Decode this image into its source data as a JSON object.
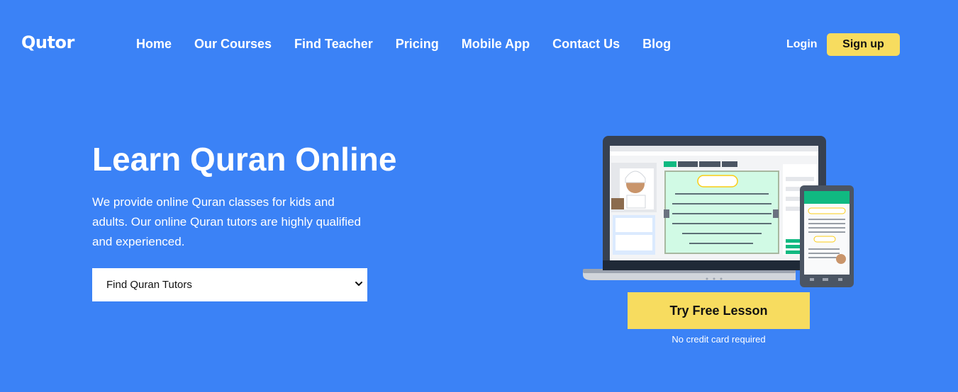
{
  "brand": {
    "logo_text": "Qutor"
  },
  "nav": {
    "items": [
      {
        "label": "Home"
      },
      {
        "label": "Our Courses"
      },
      {
        "label": "Find Teacher"
      },
      {
        "label": "Pricing"
      },
      {
        "label": "Mobile App"
      },
      {
        "label": "Contact Us"
      },
      {
        "label": "Blog"
      }
    ],
    "login_label": "Login",
    "signup_label": "Sign up"
  },
  "hero": {
    "title": "Learn Quran Online",
    "description": "We provide online Quran classes for kids and adults. Our online Quran tutors are highly qualified and experienced.",
    "select": {
      "selected": "Find Quran Tutors",
      "icon": "chevron-down-icon"
    }
  },
  "cta": {
    "button_label": "Try Free Lesson",
    "note": "No credit card required"
  },
  "colors": {
    "background": "#3b82f6",
    "accent_yellow": "#f7dc5f",
    "text": "#ffffff"
  }
}
